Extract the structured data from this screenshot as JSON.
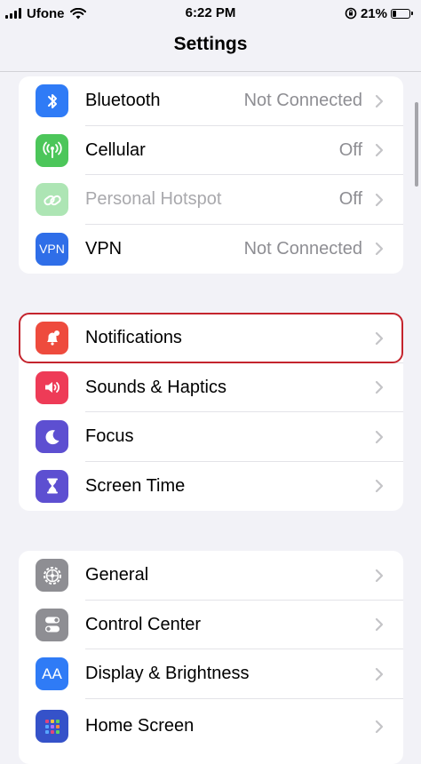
{
  "status_bar": {
    "carrier": "Ufone",
    "time": "6:22 PM",
    "battery": "21%",
    "battery_level": 0.21
  },
  "nav": {
    "title": "Settings"
  },
  "groups": [
    {
      "rows": [
        {
          "label": "Bluetooth",
          "value": "Not Connected",
          "icon": "bluetooth-icon",
          "color": "#2f7bf6"
        },
        {
          "label": "Cellular",
          "value": "Off",
          "icon": "cellular-antenna-icon",
          "color": "#4cc65a"
        },
        {
          "label": "Personal Hotspot",
          "value": "Off",
          "icon": "hotspot-link-icon",
          "color": "#4cc65a"
        },
        {
          "label": "VPN",
          "value": "Not Connected",
          "icon": "vpn-icon",
          "color": "#2f6ee8",
          "icon_text": "VPN"
        }
      ]
    },
    {
      "rows": [
        {
          "label": "Notifications",
          "icon": "bell-icon",
          "color": "#ee4b3d"
        },
        {
          "label": "Sounds & Haptics",
          "icon": "speaker-icon",
          "color": "#ee3b57"
        },
        {
          "label": "Focus",
          "icon": "moon-icon",
          "color": "#5d4fd1"
        },
        {
          "label": "Screen Time",
          "icon": "hourglass-icon",
          "color": "#5d4fd1"
        }
      ]
    },
    {
      "rows": [
        {
          "label": "General",
          "icon": "gear-icon",
          "color": "#8e8e93"
        },
        {
          "label": "Control Center",
          "icon": "toggles-icon",
          "color": "#8e8e93"
        },
        {
          "label": "Display & Brightness",
          "icon": "text-size-icon",
          "color": "#2f7bf6",
          "icon_text": "AA"
        },
        {
          "label": "Home Screen",
          "icon": "home-grid-icon",
          "color": "#3552c9"
        }
      ]
    }
  ],
  "highlighted_row": "Notifications"
}
